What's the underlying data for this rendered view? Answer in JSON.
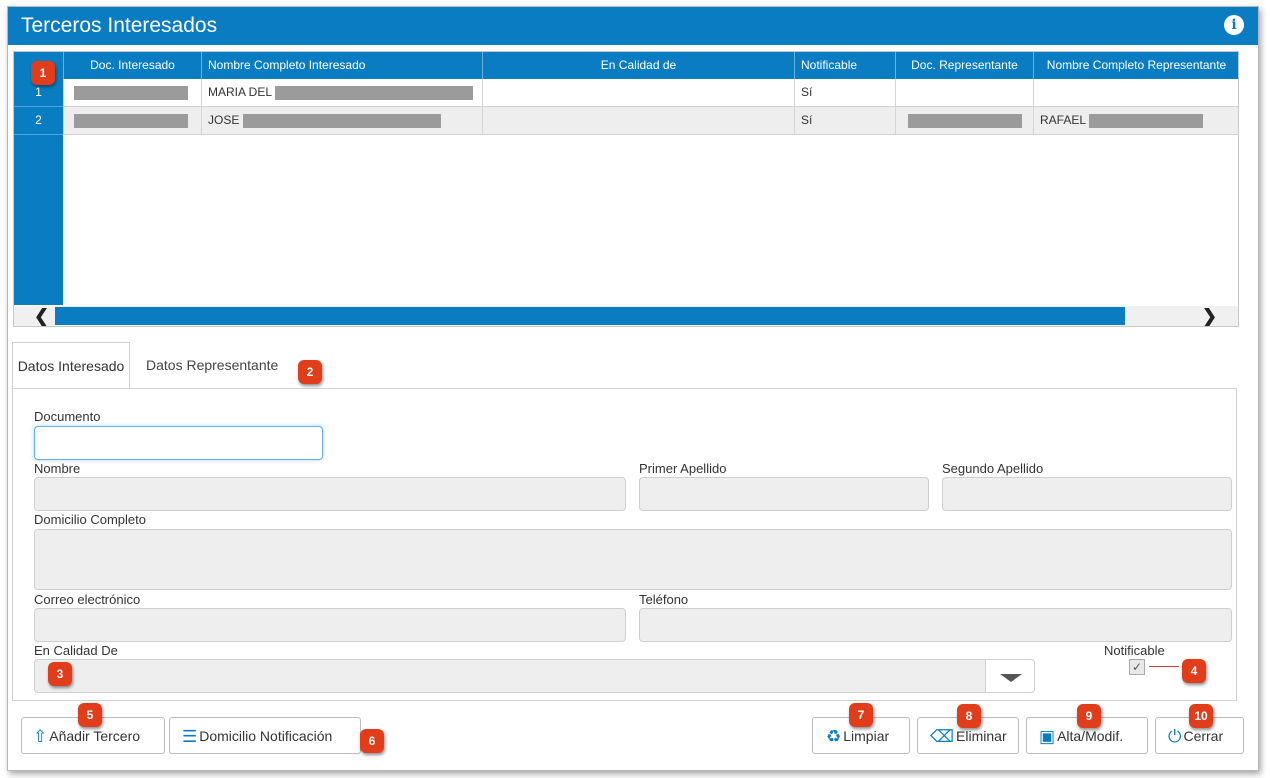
{
  "window": {
    "title": "Terceros Interesados"
  },
  "grid": {
    "columns": [
      "Doc. Interesado",
      "Nombre Completo Interesado",
      "En Calidad de",
      "Notificable",
      "Doc. Representante",
      "Nombre Completo Representante"
    ],
    "rows": [
      {
        "num": "1",
        "nombre": "MARIA DEL",
        "notificable": "Sí",
        "rep_nombre": ""
      },
      {
        "num": "2",
        "nombre": "JOSE",
        "notificable": "Sí",
        "rep_nombre": "RAFAEL"
      }
    ]
  },
  "tabs": {
    "interesado": "Datos Interesado",
    "representante": "Datos Representante"
  },
  "form": {
    "documento": "Documento",
    "nombre": "Nombre",
    "primer_apellido": "Primer Apellido",
    "segundo_apellido": "Segundo Apellido",
    "domicilio": "Domicilio Completo",
    "correo": "Correo electrónico",
    "telefono": "Teléfono",
    "calidad": "En Calidad De",
    "notificable": "Notificable"
  },
  "buttons": {
    "anadir": "Añadir Tercero",
    "domicilio": "Domicilio Notificación",
    "limpiar": "Limpiar",
    "eliminar": "Eliminar",
    "alta": "Alta/Modif.",
    "cerrar": "Cerrar"
  },
  "badges": [
    "1",
    "2",
    "3",
    "4",
    "5",
    "6",
    "7",
    "8",
    "9",
    "10"
  ],
  "colors": {
    "primary": "#0a7dc2",
    "badge": "#e23d1a"
  }
}
